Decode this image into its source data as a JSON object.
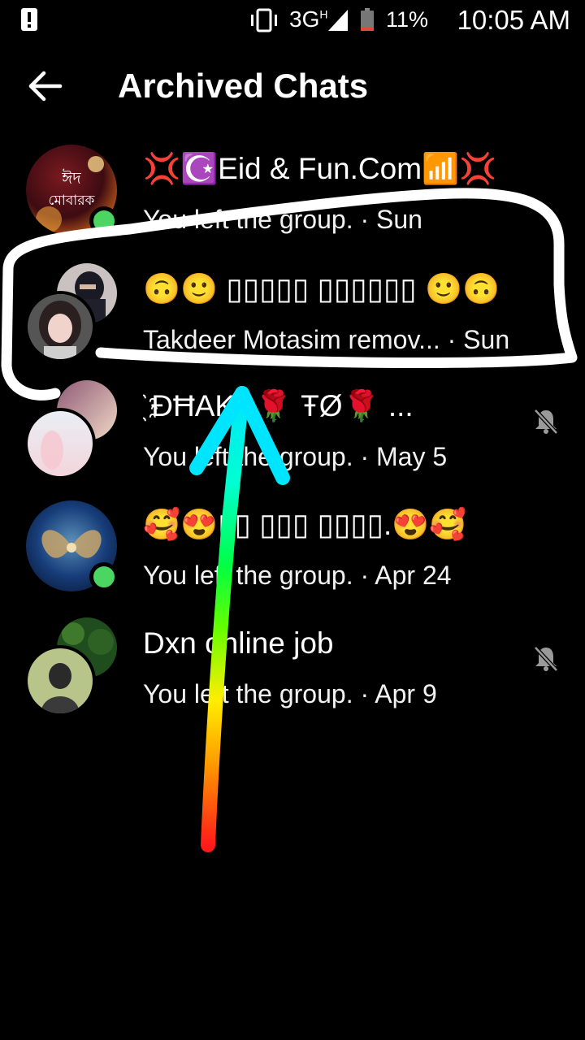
{
  "status_bar": {
    "network": "3G",
    "network_sup": "H",
    "battery": "11%",
    "time": "10:05 AM"
  },
  "header": {
    "title": "Archived Chats"
  },
  "chats": [
    {
      "name": "💢☪️Eid & Fun.Com📶💢",
      "snippet": "You left the group. · Sun",
      "online": true,
      "muted": false
    },
    {
      "name": "🙃🙂  ▯▯▯▯▯ ▯▯▯▯▯▯  🙂🙃",
      "snippet": "Takdeer Motasim remov...  · Sun",
      "online": false,
      "muted": false
    },
    {
      "name": "҈ ĐĦAKA🌹 ŦØ🌹 ...",
      "snippet": "You left the group. · May 5",
      "online": false,
      "muted": true
    },
    {
      "name": "🥰😍▯▯ ▯▯▯ ▯▯▯▯.😍🥰",
      "snippet": "You left the group. · Apr 24",
      "online": true,
      "muted": false
    },
    {
      "name": "Dxn online job",
      "snippet": "You left the group. · Apr 9",
      "online": false,
      "muted": true
    }
  ],
  "icons": {
    "back": "arrow-left-icon",
    "mute": "bell-off-icon",
    "status_alert": "alert-icon",
    "vibrate": "vibrate-icon",
    "signal": "signal-icon",
    "battery": "battery-icon"
  },
  "colors": {
    "background": "#000000",
    "text": "#ffffff",
    "presence": "#4bd663",
    "annotation_outline": "#ffffff",
    "battery_low": "#e34a2f"
  },
  "avatar_text": "ঈদ মোবারক"
}
